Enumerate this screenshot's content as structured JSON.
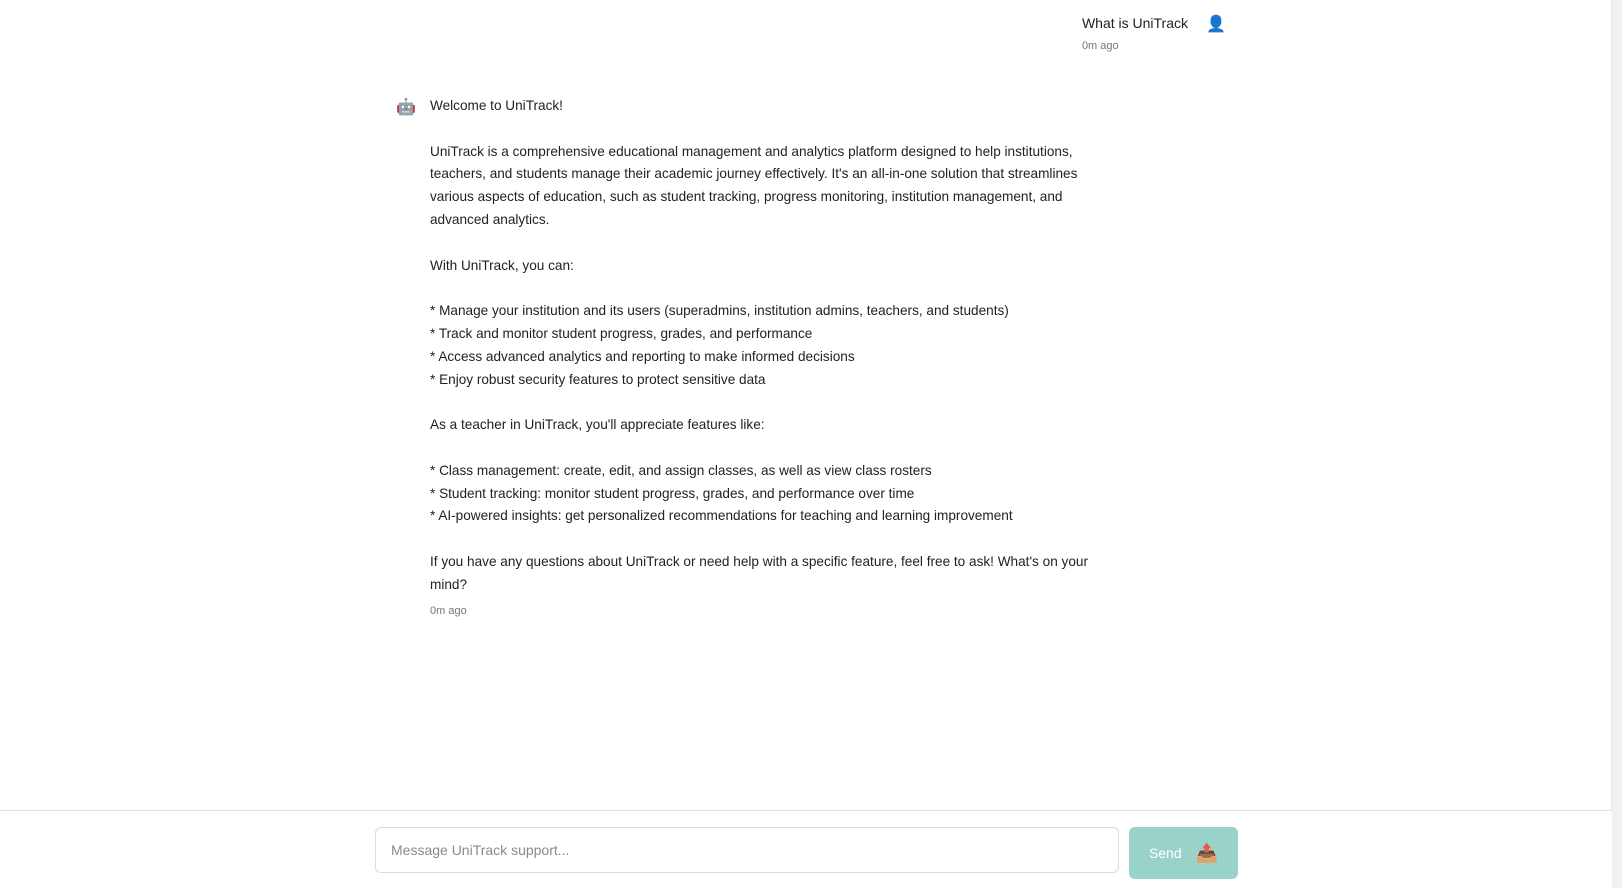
{
  "conversation": {
    "user_message": {
      "text": "What is UniTrack",
      "timestamp": "0m ago",
      "avatar_icon": "user-icon",
      "avatar_glyph": "👤"
    },
    "bot_message": {
      "avatar_icon": "robot-icon",
      "avatar_glyph": "🤖",
      "text": "Welcome to UniTrack!\n\nUniTrack is a comprehensive educational management and analytics platform designed to help institutions, teachers, and students manage their academic journey effectively. It's an all-in-one solution that streamlines various aspects of education, such as student tracking, progress monitoring, institution management, and advanced analytics.\n\nWith UniTrack, you can:\n\n* Manage your institution and its users (superadmins, institution admins, teachers, and students)\n* Track and monitor student progress, grades, and performance\n* Access advanced analytics and reporting to make informed decisions\n* Enjoy robust security features to protect sensitive data\n\nAs a teacher in UniTrack, you'll appreciate features like:\n\n* Class management: create, edit, and assign classes, as well as view class rosters\n* Student tracking: monitor student progress, grades, and performance over time\n* AI-powered insights: get personalized recommendations for teaching and learning improvement\n\nIf you have any questions about UniTrack or need help with a specific feature, feel free to ask! What's on your mind?",
      "timestamp": "0m ago"
    }
  },
  "composer": {
    "placeholder": "Message UniTrack support...",
    "value": "",
    "send_label": "Send",
    "send_icon": "outbox-tray-icon",
    "send_glyph": "📤",
    "send_color": "#98d2c9"
  }
}
